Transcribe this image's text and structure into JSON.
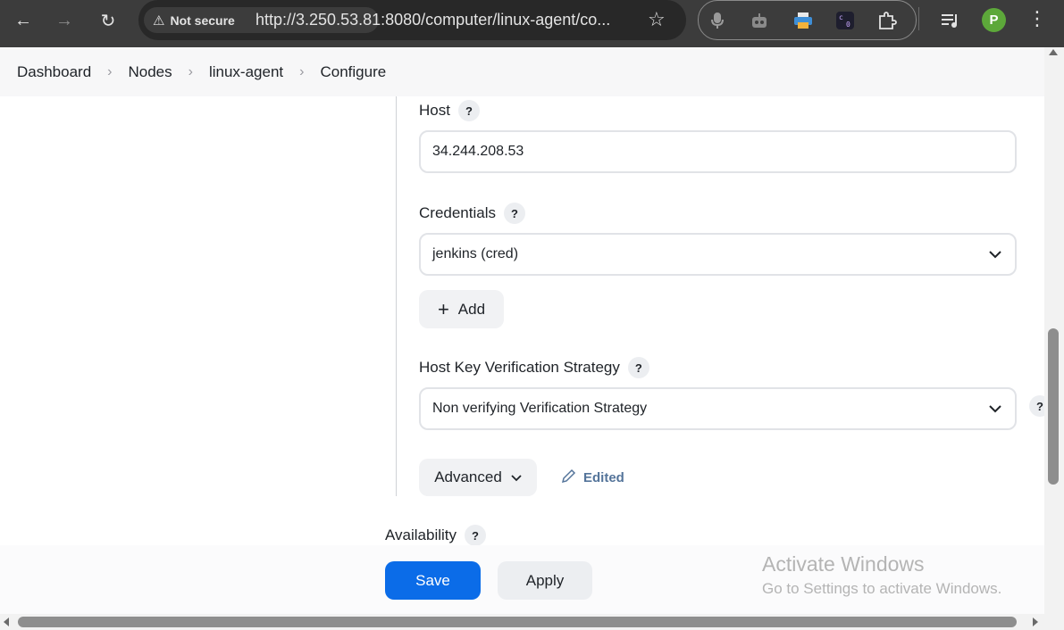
{
  "browser": {
    "security_label": "Not secure",
    "url": "http://3.250.53.81:8080/computer/linux-agent/co...",
    "profile_initial": "P"
  },
  "breadcrumb": {
    "items": [
      "Dashboard",
      "Nodes",
      "linux-agent",
      "Configure"
    ]
  },
  "form": {
    "host": {
      "label": "Host",
      "help": "?",
      "value": "34.244.208.53"
    },
    "credentials": {
      "label": "Credentials",
      "help": "?",
      "selected": "jenkins (cred)",
      "add_label": "Add"
    },
    "host_key": {
      "label": "Host Key Verification Strategy",
      "help": "?",
      "selected": "Non verifying Verification Strategy",
      "side_help": "?"
    },
    "advanced_label": "Advanced",
    "edited_label": "Edited",
    "availability": {
      "label": "Availability",
      "help": "?"
    }
  },
  "actions": {
    "save_label": "Save",
    "apply_label": "Apply"
  },
  "watermark": {
    "title": "Activate Windows",
    "subtitle": "Go to Settings to activate Windows."
  },
  "colors": {
    "primary": "#0b6ce8",
    "chrome": "#3c3c3c",
    "edited": "#54749a"
  }
}
